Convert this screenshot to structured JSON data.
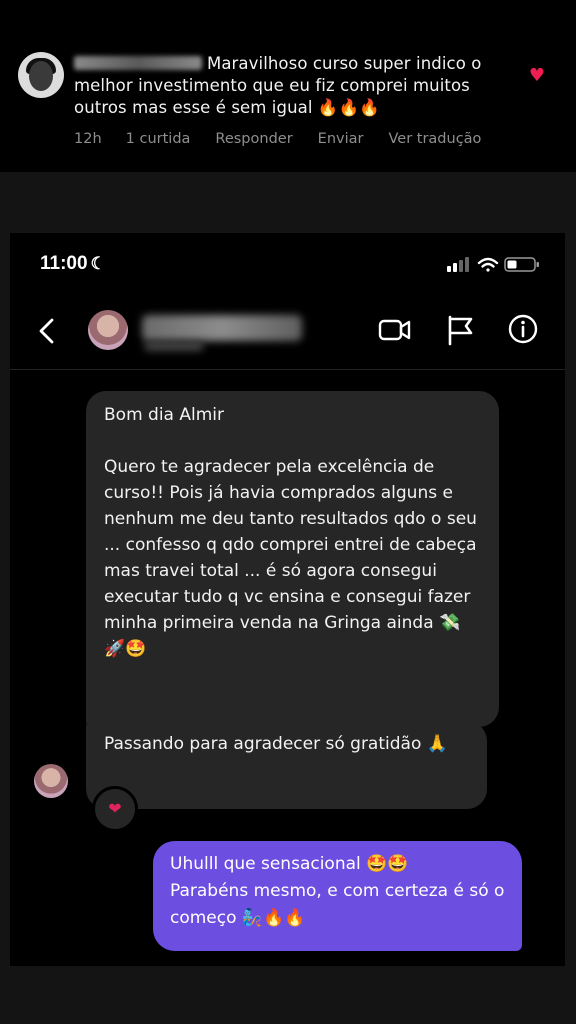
{
  "comment": {
    "text": "Maravilhoso curso super indico o melhor investimento que eu fiz comprei muitos outros mas esse é sem igual 🔥🔥🔥",
    "time": "12h",
    "likes": "1 curtida",
    "reply": "Responder",
    "send": "Enviar",
    "translate": "Ver tradução",
    "liked": true
  },
  "status_bar": {
    "time": "11:00",
    "moon": "☾"
  },
  "chat": {
    "messages": [
      {
        "direction": "incoming",
        "text": "Bom dia Almir\n\nQuero te agradecer pela excelência de curso!! Pois já havia comprados alguns e nenhum me deu tanto resultados qdo o seu ... confesso q qdo comprei entrei de cabeça mas travei total ... é só agora consegui executar tudo q vc ensina e consegui fazer minha primeira venda na Gringa ainda 💸🚀🤩"
      },
      {
        "direction": "incoming",
        "text": "Passando para agradecer só gratidão 🙏",
        "reaction": "❤"
      },
      {
        "direction": "outgoing",
        "text": "Uhulll que sensacional 🤩🤩\nParabéns mesmo, e com certeza é só o começo 🧞🔥🔥"
      }
    ]
  },
  "colors": {
    "outgoing_bubble": "#6c4fe0",
    "incoming_bubble": "#262626",
    "heart": "#ee1d52"
  }
}
